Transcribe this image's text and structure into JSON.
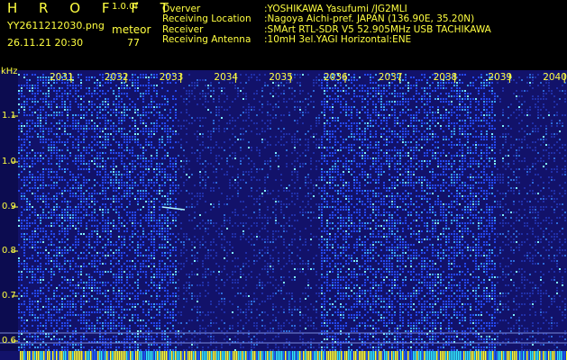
{
  "header": {
    "app_title": "H R O F F T",
    "version": "1.0.0f",
    "filename": "YY2611212030.png",
    "mode": "meteor",
    "datetime": "26.11.21 20:30",
    "count": "77"
  },
  "station_info": [
    {
      "label": "Overver",
      "value": ":YOSHIKAWA Yasufumi /JG2MLI"
    },
    {
      "label": "Receiving Location",
      "value": ":Nagoya Aichi-pref. JAPAN (136.90E, 35.20N)"
    },
    {
      "label": "Receiver",
      "value": ":SMArt RTL-SDR V5 52.905MHz USB TACHIKAWA"
    },
    {
      "label": "Receiving Antenna",
      "value": ":10mH 3el.YAGI Horizontal:ENE"
    }
  ],
  "spectrogram": {
    "unit": "kHz",
    "y_ticks": [
      "1.1",
      "1.0",
      "0.9",
      "0.8",
      "0.7",
      "0.6"
    ],
    "x_ticks": [
      "2031",
      "2032",
      "2033",
      "2034",
      "2035",
      "2036",
      "2037",
      "2038",
      "2039",
      "2040"
    ],
    "colors": {
      "background": "#0a0a4a",
      "noise": "#1e46ff",
      "bright": "#40e0ff",
      "label": "#ffff40"
    }
  }
}
